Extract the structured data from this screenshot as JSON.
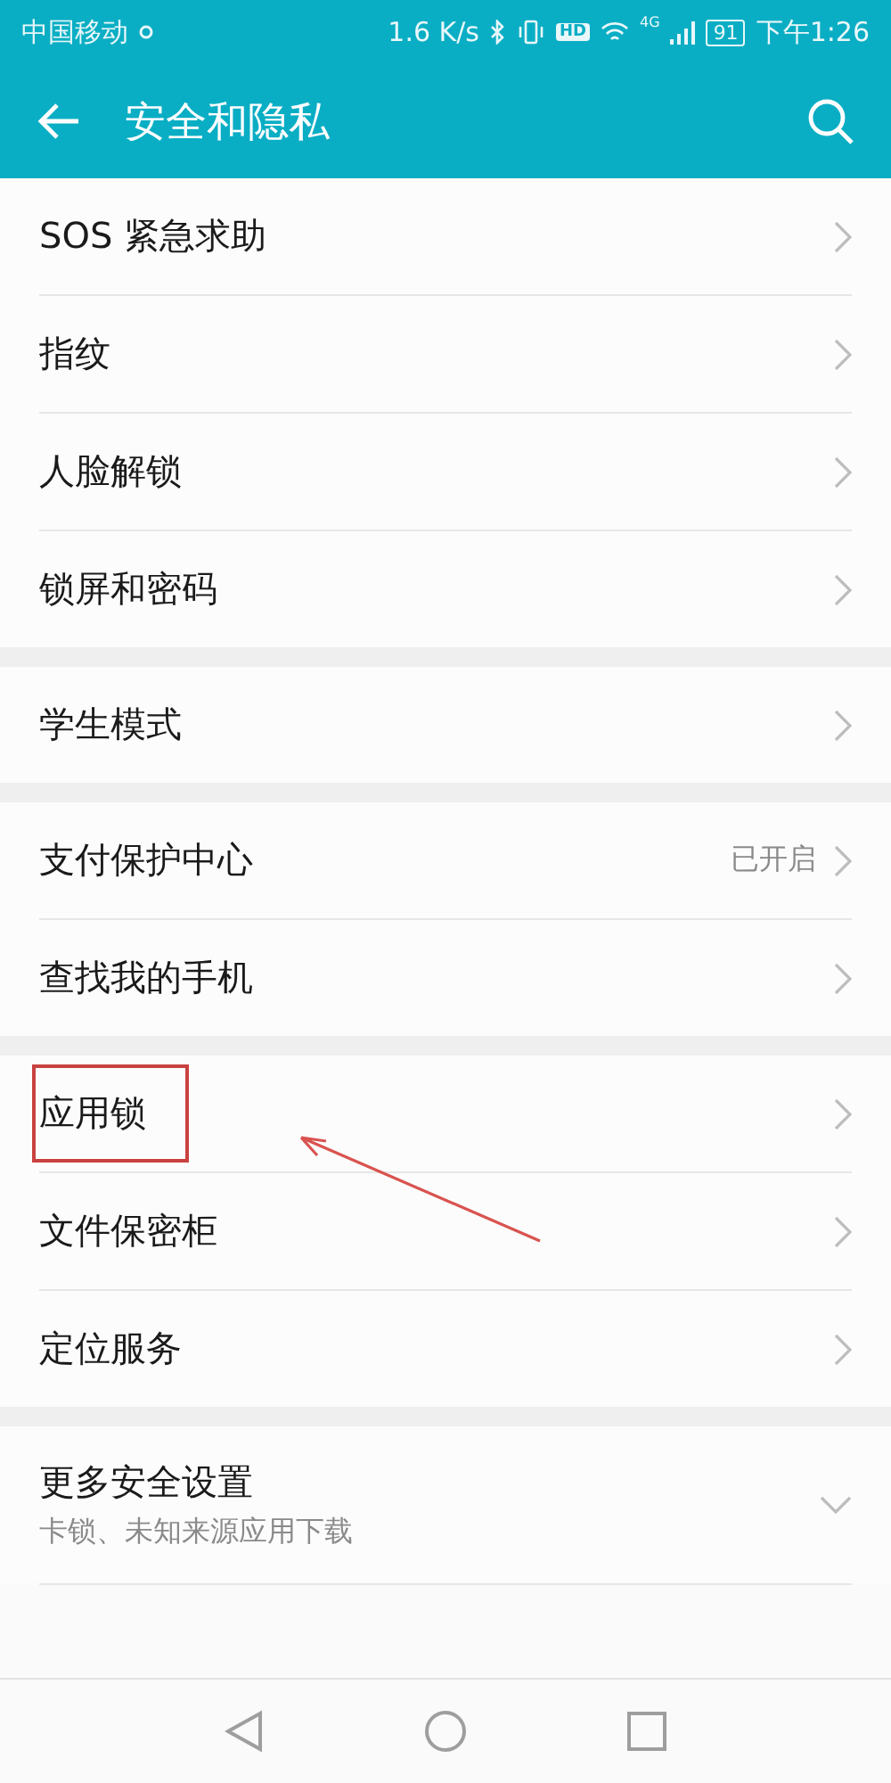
{
  "status_bar": {
    "carrier": "中国移动",
    "speed": "1.6 K/s",
    "hd": "HD",
    "network": "4G",
    "battery": "91",
    "time": "下午1:26"
  },
  "header": {
    "title": "安全和隐私"
  },
  "groups": [
    {
      "items": [
        {
          "label": "SOS 紧急求助",
          "annotated": false
        },
        {
          "label": "指纹",
          "annotated": false
        },
        {
          "label": "人脸解锁",
          "annotated": false
        },
        {
          "label": "锁屏和密码",
          "annotated": false
        }
      ]
    },
    {
      "items": [
        {
          "label": "学生模式",
          "annotated": false
        }
      ]
    },
    {
      "items": [
        {
          "label": "支付保护中心",
          "value": "已开启",
          "annotated": false
        },
        {
          "label": "查找我的手机",
          "annotated": false
        }
      ]
    },
    {
      "items": [
        {
          "label": "应用锁",
          "annotated": true
        },
        {
          "label": "文件保密柜",
          "annotated": false
        },
        {
          "label": "定位服务",
          "annotated": false
        }
      ]
    },
    {
      "items": [
        {
          "label": "更多安全设置",
          "subtitle": "卡锁、未知来源应用下载",
          "expanded": false,
          "kind": "expandable",
          "annotated": false
        }
      ]
    }
  ]
}
